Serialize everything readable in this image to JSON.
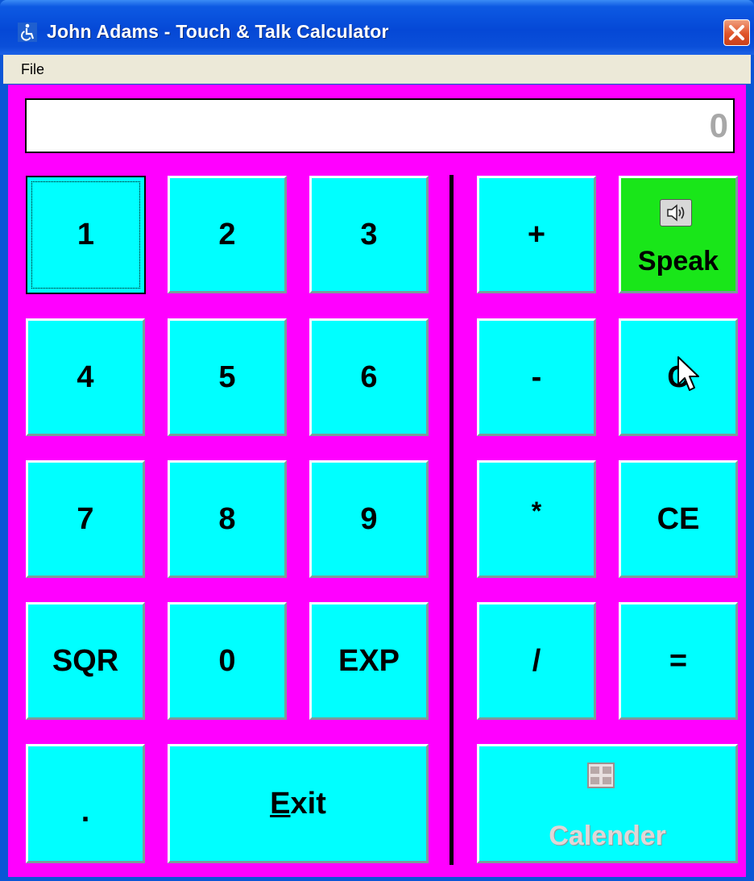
{
  "window": {
    "title": "John Adams - Touch & Talk Calculator",
    "app_icon": "wheelchair-icon",
    "close_icon": "close-icon"
  },
  "menu": {
    "file": "File"
  },
  "display": {
    "value": "0"
  },
  "keys": {
    "k1": "1",
    "k2": "2",
    "k3": "3",
    "k4": "4",
    "k5": "5",
    "k6": "6",
    "k7": "7",
    "k8": "8",
    "k9": "9",
    "sqr": "SQR",
    "k0": "0",
    "exp": "EXP",
    "dot": ".",
    "exit_mnemonic": "E",
    "exit_rest": "xit",
    "plus": "+",
    "minus": "-",
    "multiply": "*",
    "divide": "/",
    "speak": "Speak",
    "clear": "C",
    "clear_entry": "CE",
    "equals": "=",
    "calendar": "Calender"
  },
  "colors": {
    "background": "#FF00FF",
    "button": "#00FFFF",
    "speak_button": "#19E619",
    "titlebar": "#0548D6"
  }
}
